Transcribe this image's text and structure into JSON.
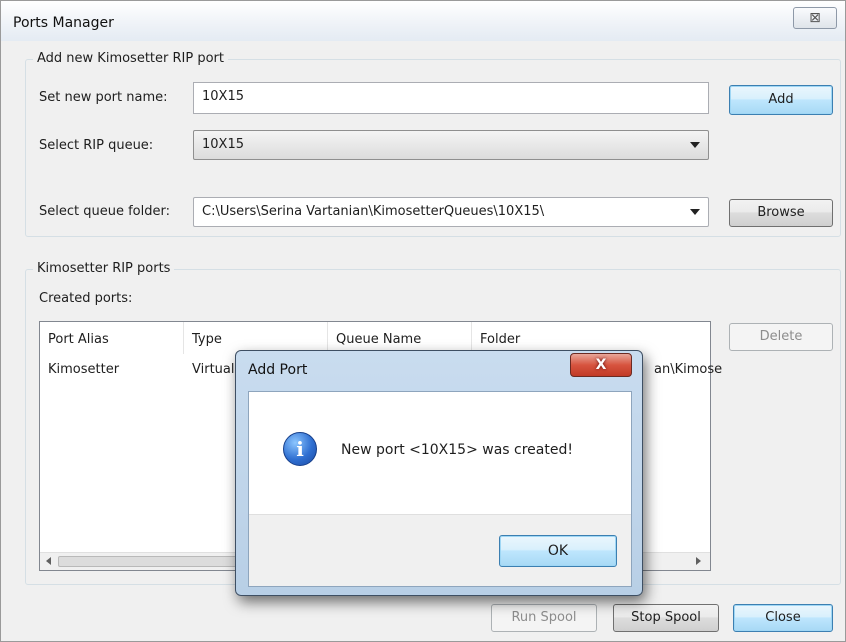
{
  "window": {
    "title": "Ports Manager",
    "close_glyph": "⊠"
  },
  "add_group": {
    "legend": "Add new Kimosetter RIP port",
    "port_name_label": "Set new port name:",
    "port_name_value": "10X15",
    "add_button": "Add",
    "queue_label": "Select RIP queue:",
    "queue_value": "10X15",
    "folder_label": "Select queue folder:",
    "folder_value": "C:\\Users\\Serina Vartanian\\KimosetterQueues\\10X15\\",
    "browse_button": "Browse"
  },
  "ports_group": {
    "legend": "Kimosetter RIP ports",
    "created_label": "Created ports:",
    "columns": [
      "Port Alias",
      "Type",
      "Queue Name",
      "Folder"
    ],
    "rows": [
      {
        "alias": "Kimosetter",
        "type": "Virtual",
        "folder_tail": "an\\Kimose"
      }
    ],
    "delete_button": "Delete"
  },
  "footer": {
    "run_spool": "Run Spool",
    "stop_spool": "Stop Spool",
    "close": "Close"
  },
  "dialog": {
    "title": "Add Port",
    "close_glyph": "X",
    "icon_glyph": "i",
    "message": "New port <10X15> was created!",
    "ok_button": "OK"
  }
}
